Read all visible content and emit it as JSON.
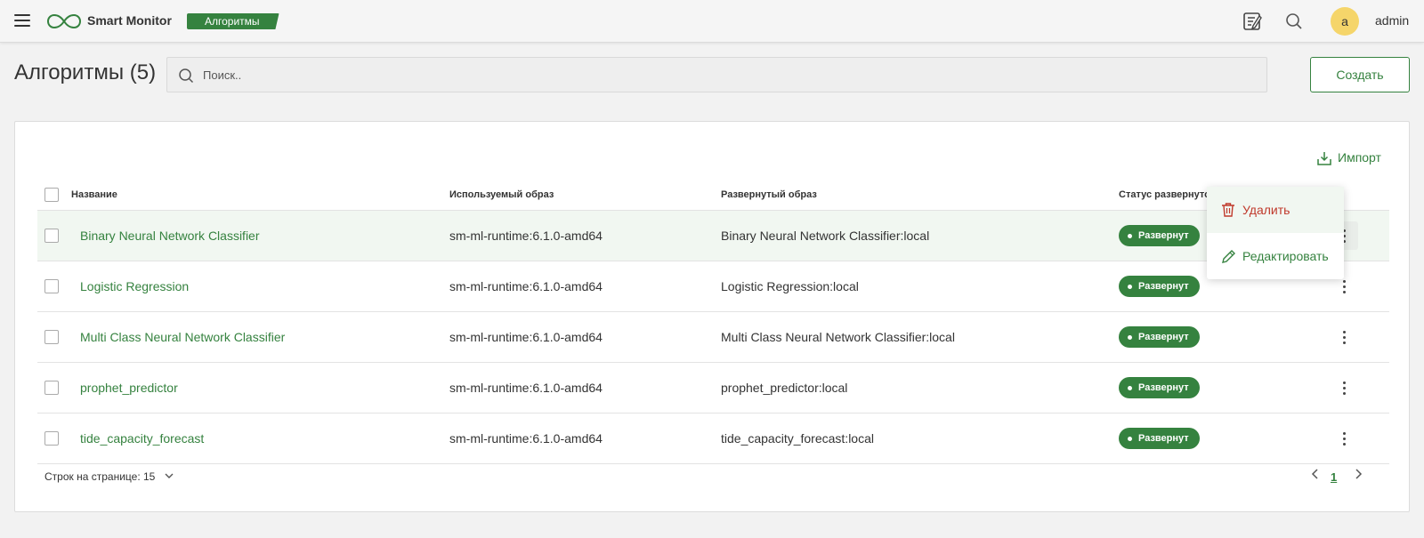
{
  "header": {
    "app_title": "Smart Monitor",
    "section_badge": "Алгоритмы",
    "user_initial": "a",
    "username": "admin"
  },
  "page": {
    "title": "Алгоритмы (5)",
    "search_placeholder": "Поиск..",
    "create_label": "Создать",
    "import_label": "Импорт"
  },
  "table": {
    "columns": [
      "Название",
      "Используемый образ",
      "Развернутый образ",
      "Статус развернутого"
    ],
    "rows": [
      {
        "name": "Binary Neural Network Classifier",
        "image": "sm-ml-runtime:6.1.0-amd64",
        "deployed": "Binary Neural Network Classifier:local",
        "status": "Развернут"
      },
      {
        "name": "Logistic Regression",
        "image": "sm-ml-runtime:6.1.0-amd64",
        "deployed": "Logistic Regression:local",
        "status": "Развернут"
      },
      {
        "name": "Multi Class Neural Network Classifier",
        "image": "sm-ml-runtime:6.1.0-amd64",
        "deployed": "Multi Class Neural Network Classifier:local",
        "status": "Развернут"
      },
      {
        "name": "prophet_predictor",
        "image": "sm-ml-runtime:6.1.0-amd64",
        "deployed": "prophet_predictor:local",
        "status": "Развернут"
      },
      {
        "name": "tide_capacity_forecast",
        "image": "sm-ml-runtime:6.1.0-amd64",
        "deployed": "tide_capacity_forecast:local",
        "status": "Развернут"
      }
    ]
  },
  "footer": {
    "rows_per_page": "Строк на странице: 15",
    "current_page": "1"
  },
  "menu": {
    "delete_label": "Удалить",
    "edit_label": "Редактировать"
  },
  "colors": {
    "accent": "#35823f",
    "danger": "#c0392b",
    "avatar": "#f5d56a"
  }
}
